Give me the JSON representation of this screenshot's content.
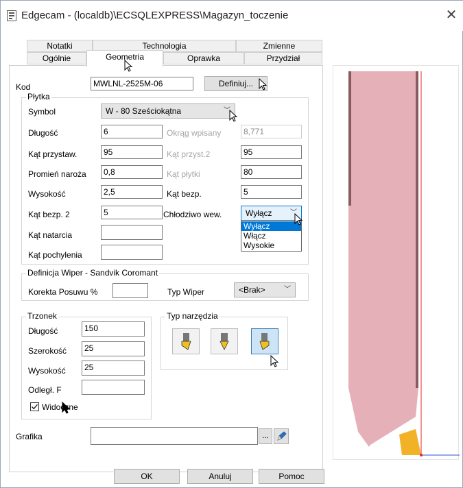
{
  "window": {
    "title": "Edgecam - (localdb)\\ECSQLEXPRESS\\Magazyn_toczenie",
    "close_glyph": "✕"
  },
  "tabs": {
    "row1": [
      "Notatki",
      "Technologia",
      "Zmienne"
    ],
    "row2": [
      "Ogólnie",
      "Geometria",
      "Oprawka",
      "Przydział"
    ],
    "active": "Geometria"
  },
  "kod": {
    "label": "Kod",
    "value": "MWLNL-2525M-06",
    "define_label": "Definiuj..."
  },
  "plytka": {
    "caption": "Płytka",
    "symbol_label": "Symbol",
    "symbol_value": "W - 80 Sześciokątna",
    "dlugosc_label": "Długość",
    "dlugosc_value": "6",
    "okrag_label": "Okrąg wpisany",
    "okrag_value": "8,771",
    "kat_przystaw_label": "Kąt przystaw.",
    "kat_przystaw_value": "95",
    "kat_przyst2_label": "Kąt przyst.2",
    "kat_przyst2_value": "95",
    "promien_label": "Promień naroża",
    "promien_value": "0,8",
    "kat_plytki_label": "Kąt płytki",
    "kat_plytki_value": "80",
    "wysokosc_label": "Wysokość",
    "wysokosc_value": "2,5",
    "kat_bezp_label": "Kąt bezp.",
    "kat_bezp_value": "5",
    "kat_bezp2_label": "Kąt bezp. 2",
    "kat_bezp2_value": "5",
    "chlodziwo_label": "Chłodziwo wew.",
    "chlodziwo_value": "Wyłącz",
    "chlodziwo_options": [
      "Wyłącz",
      "Włącz",
      "Wysokie"
    ],
    "kat_natarcia_label": "Kąt natarcia",
    "kat_natarcia_value": "",
    "kat_pochylenia_label": "Kąt pochylenia",
    "kat_pochylenia_value": ""
  },
  "wiper": {
    "caption": "Definicja Wiper - Sandvik Coromant",
    "korekta_label": "Korekta Posuwu %",
    "korekta_value": "",
    "typ_label": "Typ Wiper",
    "typ_value": "<Brak>"
  },
  "trzonek": {
    "caption": "Trzonek",
    "dlugosc_label": "Długość",
    "dlugosc_value": "150",
    "szerokosc_label": "Szerokość",
    "szerokosc_value": "25",
    "wysokosc_label": "Wysokość",
    "wysokosc_value": "25",
    "odleg_label": "Odległ. F",
    "odleg_value": "",
    "widoczne_label": "Widoczne",
    "widoczne_checked": true
  },
  "typ_narzedzia": {
    "caption": "Typ narzędzia",
    "selected_index": 2
  },
  "grafika": {
    "label": "Grafika",
    "value": "",
    "browse_label": "..."
  },
  "footer": {
    "ok": "OK",
    "cancel": "Anuluj",
    "help": "Pomoc"
  },
  "colors": {
    "shank": "#e6b0b8",
    "shank_edge": "#8a5a60",
    "insert": "#f2b227",
    "axis_red": "#e8262a",
    "axis_blue": "#2a4fd8",
    "select_blue": "#0078d7"
  }
}
